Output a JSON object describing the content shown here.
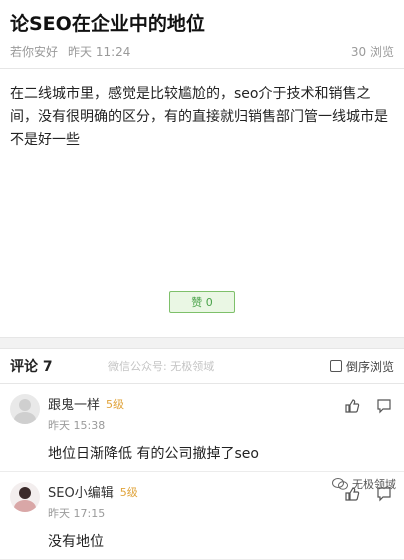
{
  "article": {
    "title": "论SEO在企业中的地位",
    "author": "若你安好",
    "time": "昨天 11:24",
    "views": "30 浏览",
    "body": "在二线城市里，感觉是比较尴尬的，seo介于技术和销售之间，没有很明确的区分，有的直接就归销售部门管一线城市是不是好一些",
    "like_label": "赞 0"
  },
  "comments_bar": {
    "title": "评论 7",
    "watermark": "微信公众号: 无极领域",
    "sort_label": "倒序浏览"
  },
  "comments": [
    {
      "name": "跟鬼一样",
      "level": "5级",
      "time": "昨天 15:38",
      "text": "地位日渐降低 有的公司撤掉了seo"
    },
    {
      "name": "SEO小编辑",
      "level": "5级",
      "time": "昨天 17:15",
      "text": "没有地位"
    }
  ],
  "brand": {
    "label": "无极领域"
  },
  "colors": {
    "accent_green": "#4aa24a",
    "level_orange": "#e0a33a"
  }
}
